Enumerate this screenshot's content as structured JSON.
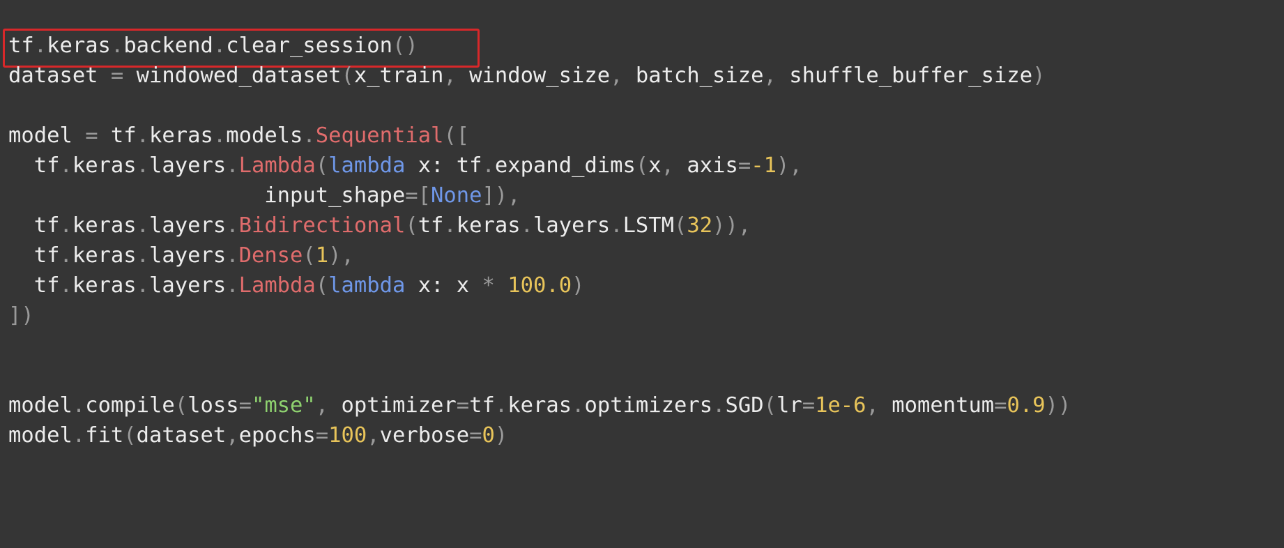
{
  "colors": {
    "background": "#353535",
    "default_text": "#ececec",
    "punctuation": "#9a9a9a",
    "class_name": "#e06c6c",
    "keyword": "#6f97e8",
    "number": "#e8c45a",
    "string": "#8ed16f",
    "highlight_border": "#d8282a"
  },
  "highlight": {
    "target": "line-1",
    "note": "red box around first line"
  },
  "lines": [
    [
      [
        "tf",
        "default"
      ],
      [
        ".",
        "punct"
      ],
      [
        "keras",
        "default"
      ],
      [
        ".",
        "punct"
      ],
      [
        "backend",
        "default"
      ],
      [
        ".",
        "punct"
      ],
      [
        "clear_session",
        "default"
      ],
      [
        "()",
        "punct"
      ]
    ],
    [
      [
        "dataset ",
        "default"
      ],
      [
        "=",
        "punct"
      ],
      [
        " windowed_dataset",
        "default"
      ],
      [
        "(",
        "punct"
      ],
      [
        "x_train",
        "default"
      ],
      [
        ",",
        "punct"
      ],
      [
        " window_size",
        "default"
      ],
      [
        ",",
        "punct"
      ],
      [
        " batch_size",
        "default"
      ],
      [
        ",",
        "punct"
      ],
      [
        " shuffle_buffer_size",
        "default"
      ],
      [
        ")",
        "punct"
      ]
    ],
    [],
    [
      [
        "model ",
        "default"
      ],
      [
        "=",
        "punct"
      ],
      [
        " tf",
        "default"
      ],
      [
        ".",
        "punct"
      ],
      [
        "keras",
        "default"
      ],
      [
        ".",
        "punct"
      ],
      [
        "models",
        "default"
      ],
      [
        ".",
        "punct"
      ],
      [
        "Sequential",
        "class"
      ],
      [
        "([",
        "punct"
      ]
    ],
    [
      [
        "  tf",
        "default"
      ],
      [
        ".",
        "punct"
      ],
      [
        "keras",
        "default"
      ],
      [
        ".",
        "punct"
      ],
      [
        "layers",
        "default"
      ],
      [
        ".",
        "punct"
      ],
      [
        "Lambda",
        "class"
      ],
      [
        "(",
        "punct"
      ],
      [
        "lambda",
        "keyword"
      ],
      [
        " x: tf",
        "default"
      ],
      [
        ".",
        "punct"
      ],
      [
        "expand_dims",
        "default"
      ],
      [
        "(",
        "punct"
      ],
      [
        "x",
        "default"
      ],
      [
        ",",
        "punct"
      ],
      [
        " axis",
        "default"
      ],
      [
        "=",
        "punct"
      ],
      [
        "-1",
        "number"
      ],
      [
        "),",
        "punct"
      ]
    ],
    [
      [
        "                    input_shape",
        "default"
      ],
      [
        "=[",
        "punct"
      ],
      [
        "None",
        "keyword"
      ],
      [
        "]),",
        "punct"
      ]
    ],
    [
      [
        "  tf",
        "default"
      ],
      [
        ".",
        "punct"
      ],
      [
        "keras",
        "default"
      ],
      [
        ".",
        "punct"
      ],
      [
        "layers",
        "default"
      ],
      [
        ".",
        "punct"
      ],
      [
        "Bidirectional",
        "class"
      ],
      [
        "(",
        "punct"
      ],
      [
        "tf",
        "default"
      ],
      [
        ".",
        "punct"
      ],
      [
        "keras",
        "default"
      ],
      [
        ".",
        "punct"
      ],
      [
        "layers",
        "default"
      ],
      [
        ".",
        "punct"
      ],
      [
        "LSTM",
        "default"
      ],
      [
        "(",
        "punct"
      ],
      [
        "32",
        "number"
      ],
      [
        ")),",
        "punct"
      ]
    ],
    [
      [
        "  tf",
        "default"
      ],
      [
        ".",
        "punct"
      ],
      [
        "keras",
        "default"
      ],
      [
        ".",
        "punct"
      ],
      [
        "layers",
        "default"
      ],
      [
        ".",
        "punct"
      ],
      [
        "Dense",
        "class"
      ],
      [
        "(",
        "punct"
      ],
      [
        "1",
        "number"
      ],
      [
        "),",
        "punct"
      ]
    ],
    [
      [
        "  tf",
        "default"
      ],
      [
        ".",
        "punct"
      ],
      [
        "keras",
        "default"
      ],
      [
        ".",
        "punct"
      ],
      [
        "layers",
        "default"
      ],
      [
        ".",
        "punct"
      ],
      [
        "Lambda",
        "class"
      ],
      [
        "(",
        "punct"
      ],
      [
        "lambda",
        "keyword"
      ],
      [
        " x: x ",
        "default"
      ],
      [
        "*",
        "punct"
      ],
      [
        " ",
        "default"
      ],
      [
        "100.0",
        "number"
      ],
      [
        ")",
        "punct"
      ]
    ],
    [
      [
        "])",
        "punct"
      ]
    ],
    [],
    [],
    [
      [
        "model",
        "default"
      ],
      [
        ".",
        "punct"
      ],
      [
        "compile",
        "default"
      ],
      [
        "(",
        "punct"
      ],
      [
        "loss",
        "default"
      ],
      [
        "=",
        "punct"
      ],
      [
        "\"mse\"",
        "string"
      ],
      [
        ",",
        "punct"
      ],
      [
        " optimizer",
        "default"
      ],
      [
        "=",
        "punct"
      ],
      [
        "tf",
        "default"
      ],
      [
        ".",
        "punct"
      ],
      [
        "keras",
        "default"
      ],
      [
        ".",
        "punct"
      ],
      [
        "optimizers",
        "default"
      ],
      [
        ".",
        "punct"
      ],
      [
        "SGD",
        "default"
      ],
      [
        "(",
        "punct"
      ],
      [
        "lr",
        "default"
      ],
      [
        "=",
        "punct"
      ],
      [
        "1e-6",
        "number"
      ],
      [
        ",",
        "punct"
      ],
      [
        " momentum",
        "default"
      ],
      [
        "=",
        "punct"
      ],
      [
        "0.9",
        "number"
      ],
      [
        "))",
        "punct"
      ]
    ],
    [
      [
        "model",
        "default"
      ],
      [
        ".",
        "punct"
      ],
      [
        "fit",
        "default"
      ],
      [
        "(",
        "punct"
      ],
      [
        "dataset",
        "default"
      ],
      [
        ",",
        "punct"
      ],
      [
        "epochs",
        "default"
      ],
      [
        "=",
        "punct"
      ],
      [
        "100",
        "number"
      ],
      [
        ",",
        "punct"
      ],
      [
        "verbose",
        "default"
      ],
      [
        "=",
        "punct"
      ],
      [
        "0",
        "number"
      ],
      [
        ")",
        "punct"
      ]
    ]
  ]
}
